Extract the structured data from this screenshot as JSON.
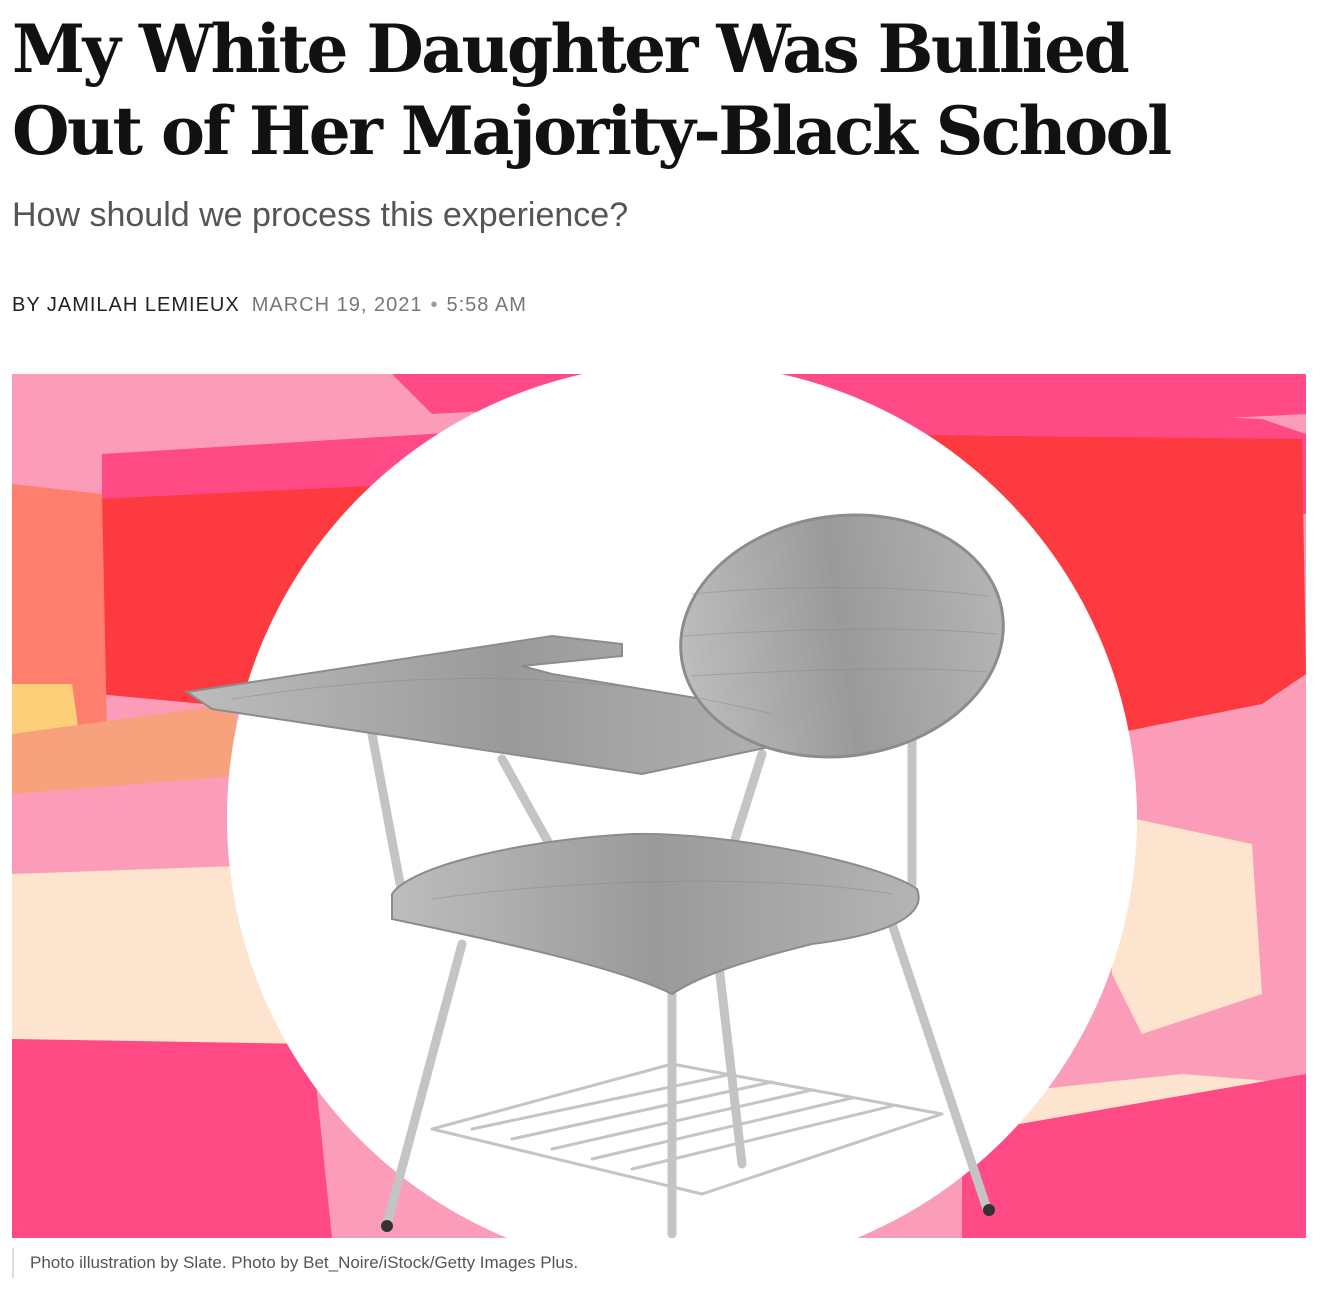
{
  "article": {
    "headline_line1": "My White Daughter Was Bullied",
    "headline_line2": "Out of Her Majority-Black School",
    "dek": "How should we process this experience?",
    "byline": {
      "author": "BY JAMILAH LEMIEUX",
      "date": "MARCH 19, 2021",
      "separator": "•",
      "time": "5:58 AM"
    }
  },
  "hero": {
    "caption": "Photo illustration by Slate. Photo by Bet_Noire/iStock/Getty Images Plus.",
    "colors": {
      "hot_pink": "#ff4a85",
      "red": "#fd3a3f",
      "light_pink": "#fb9db8",
      "salmon": "#ff7e6e",
      "peach": "#f7a27c",
      "cream": "#fde4cf",
      "yellow": "#fcd078",
      "white_circle": "#ffffff",
      "chair_gray": "#a5a5a5",
      "chair_metal": "#c4c4c4"
    }
  }
}
